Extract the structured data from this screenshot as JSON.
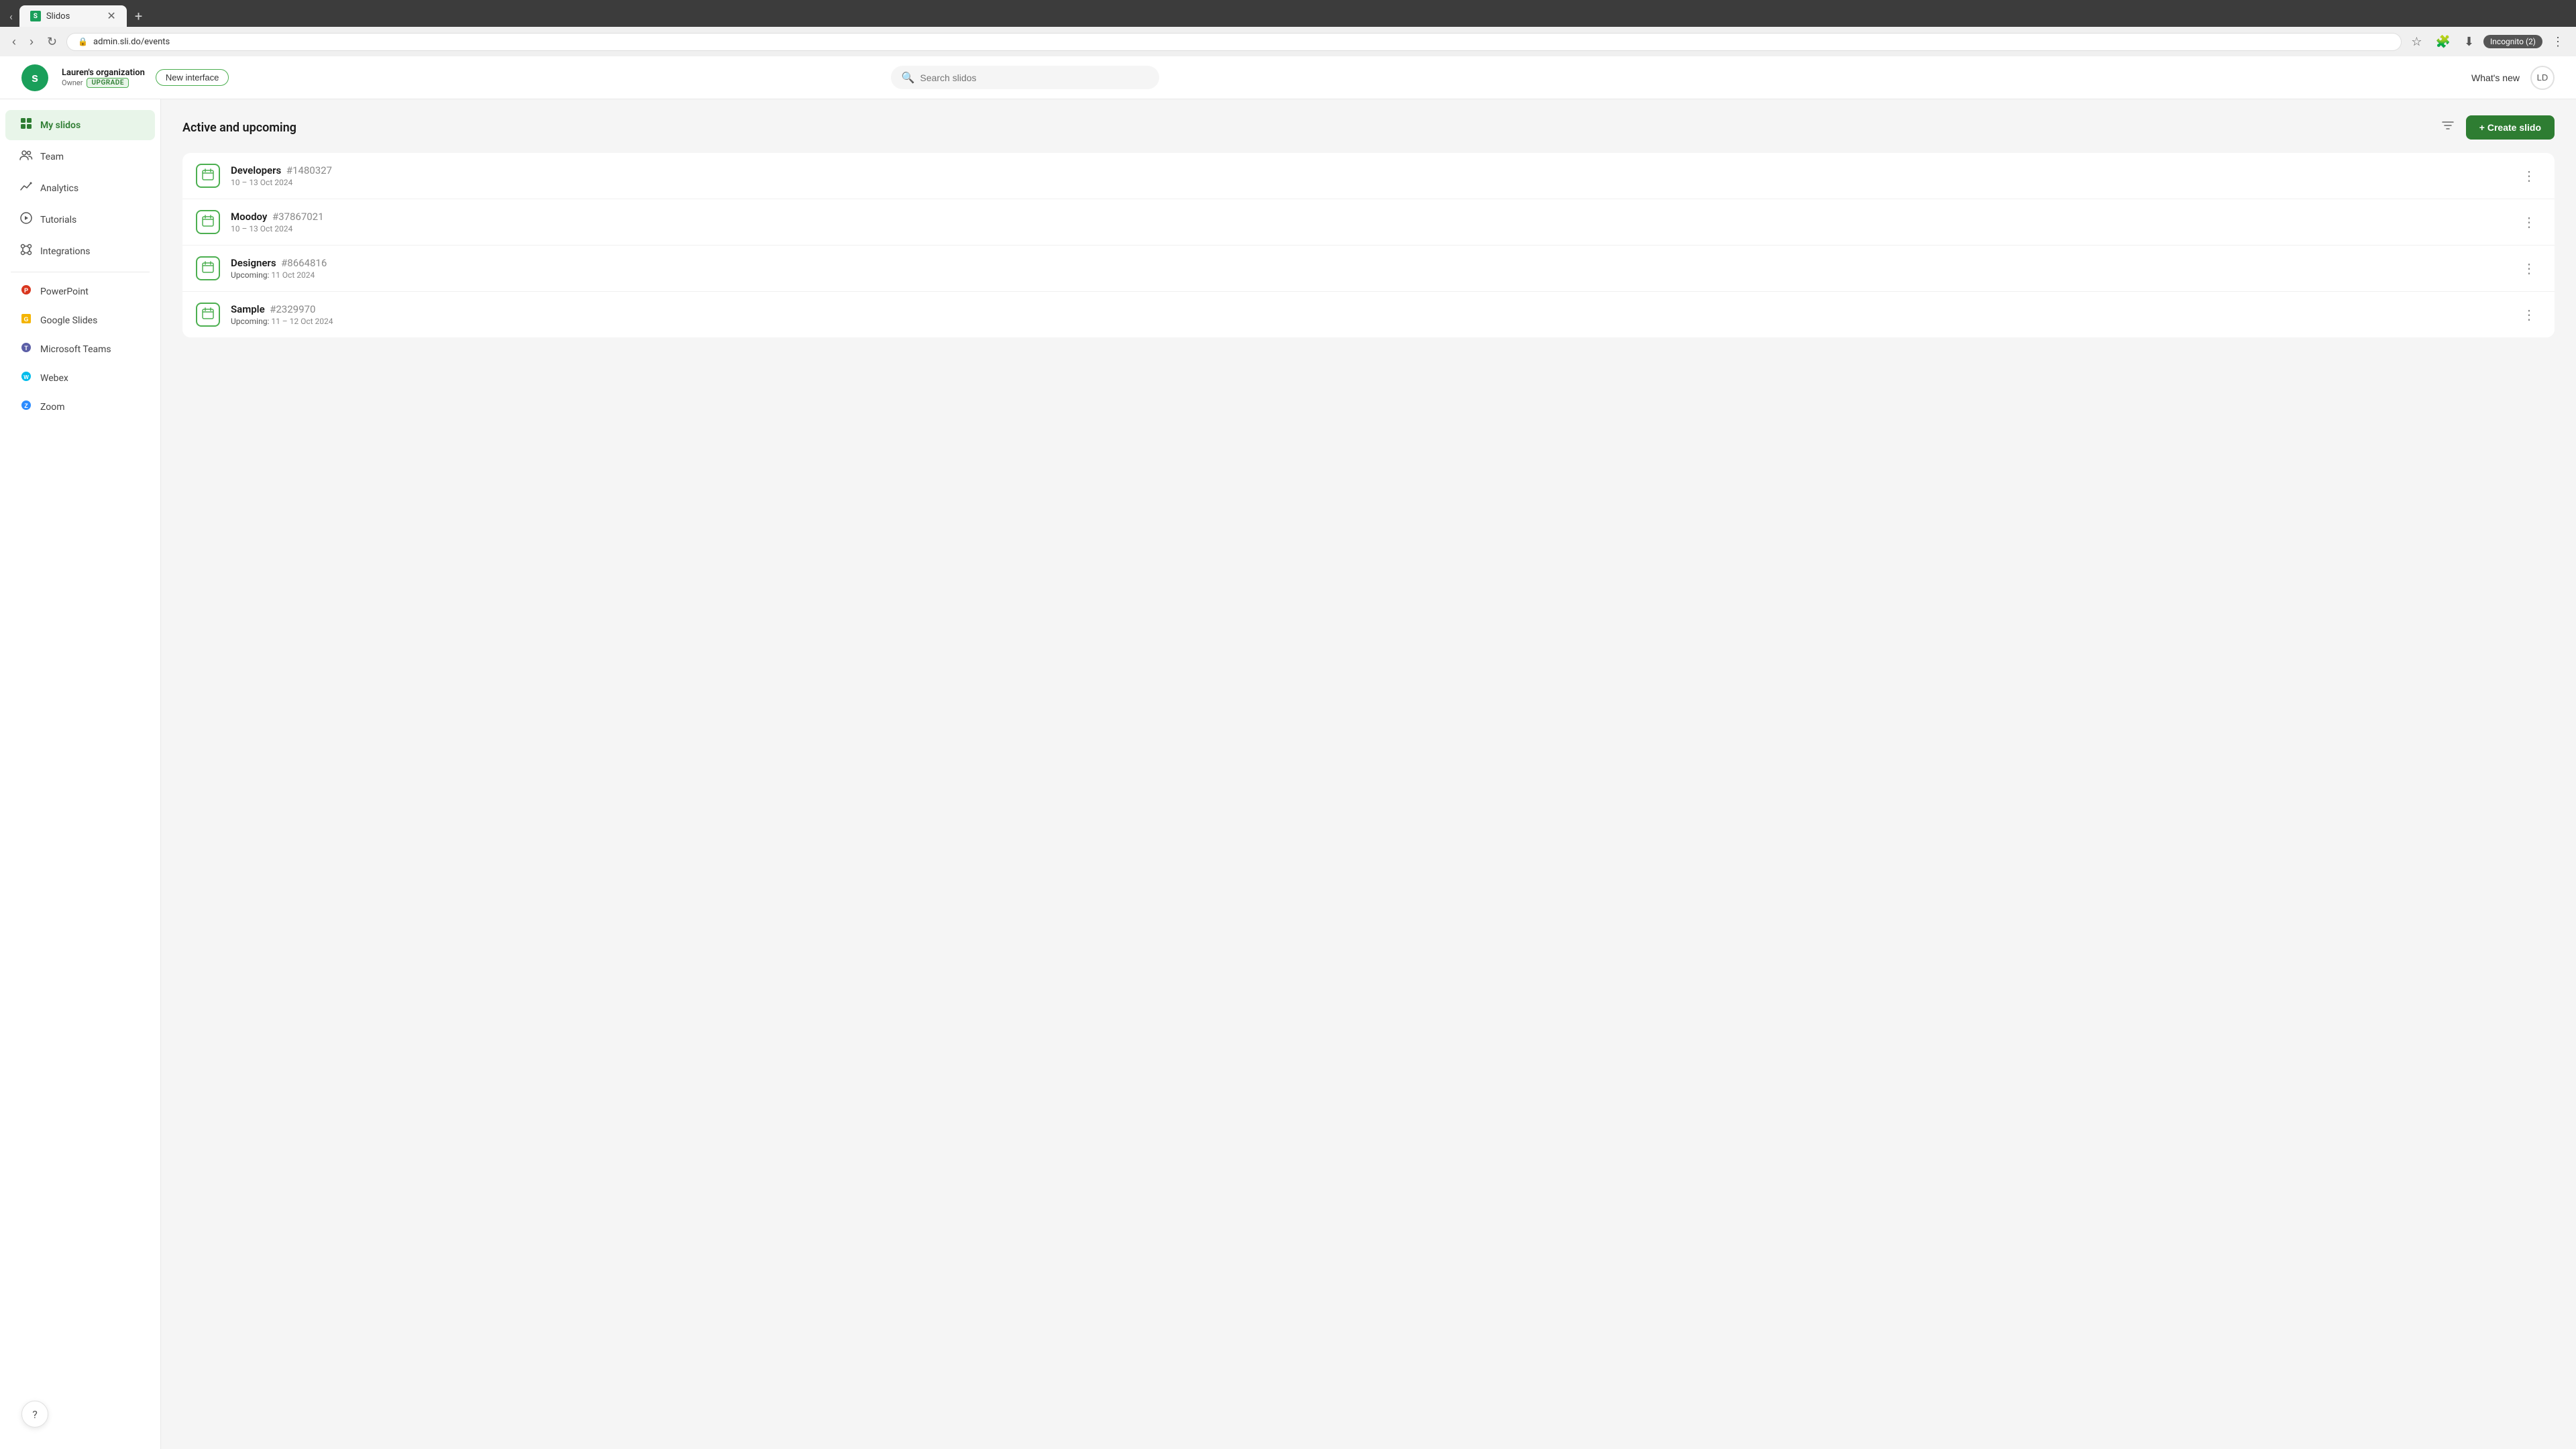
{
  "browser": {
    "tab_favicon": "S",
    "tab_title": "Slidos",
    "new_tab_icon": "+",
    "address": "admin.sli.do/events",
    "incognito_label": "Incognito (2)"
  },
  "header": {
    "logo_alt": "Slido",
    "org_name": "Lauren's organization",
    "org_role": "Owner",
    "upgrade_label": "UPGRADE",
    "new_interface_label": "New interface",
    "search_placeholder": "Search slidos",
    "whats_new_label": "What's new",
    "avatar_initials": "LD"
  },
  "sidebar": {
    "items": [
      {
        "id": "my-slidos",
        "label": "My slidos",
        "icon": "⊞",
        "active": true
      },
      {
        "id": "team",
        "label": "Team",
        "icon": "👤",
        "active": false
      },
      {
        "id": "analytics",
        "label": "Analytics",
        "icon": "📈",
        "active": false
      },
      {
        "id": "tutorials",
        "label": "Tutorials",
        "icon": "🎓",
        "active": false
      },
      {
        "id": "integrations",
        "label": "Integrations",
        "icon": "🔗",
        "active": false
      }
    ],
    "integrations": [
      {
        "id": "powerpoint",
        "label": "PowerPoint",
        "color": "#d9361e"
      },
      {
        "id": "google-slides",
        "label": "Google Slides",
        "color": "#f4b400"
      },
      {
        "id": "microsoft-teams",
        "label": "Microsoft Teams",
        "color": "#5b5ea6"
      },
      {
        "id": "webex",
        "label": "Webex",
        "color": "#00bceb"
      },
      {
        "id": "zoom",
        "label": "Zoom",
        "color": "#2d8cff"
      }
    ]
  },
  "main": {
    "section_title": "Active and upcoming",
    "create_button_label": "+ Create slido",
    "events": [
      {
        "name": "Developers",
        "id": "#1480327",
        "date": "10 – 13 Oct 2024",
        "upcoming": false
      },
      {
        "name": "Moodoy",
        "id": "#37867021",
        "date": "10 – 13 Oct 2024",
        "upcoming": false
      },
      {
        "name": "Designers",
        "id": "#8664816",
        "date": "11 Oct 2024",
        "upcoming": true
      },
      {
        "name": "Sample",
        "id": "#2329970",
        "date": "11 – 12 Oct 2024",
        "upcoming": true
      }
    ]
  },
  "help": {
    "icon": "?"
  }
}
